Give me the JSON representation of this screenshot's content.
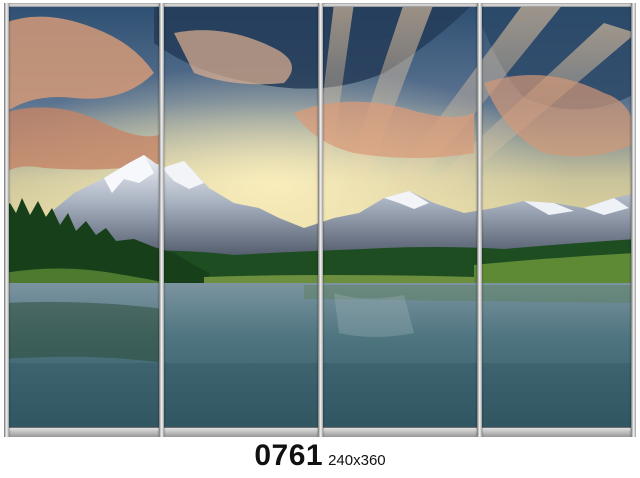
{
  "caption": {
    "code": "0761",
    "size": "240x360"
  },
  "scene": {
    "subject": "mountain-lake-landscape",
    "panels": 4,
    "colors": {
      "sky_top": "#2f5678",
      "sky_glow": "#e9d79a",
      "cloud_warm": "#c98a6a",
      "snow": "#f1f3f6",
      "rock": "#5d6778",
      "forest": "#1f4a1f",
      "water": "#3f6470",
      "frame": "#c8c8c8"
    }
  }
}
